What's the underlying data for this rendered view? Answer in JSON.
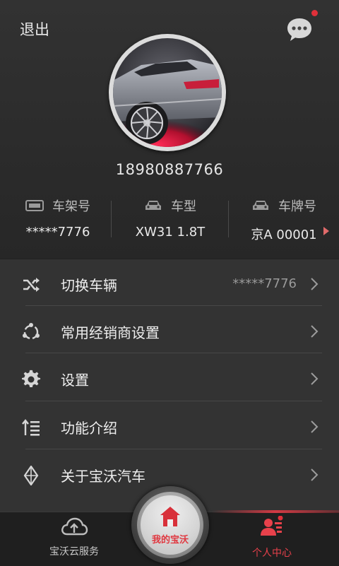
{
  "header": {
    "logout_label": "退出"
  },
  "profile": {
    "phone": "18980887766"
  },
  "vehicle_info": {
    "frame_label": "车架号",
    "frame_value": "*****7776",
    "model_label": "车型",
    "model_value": "XW31 1.8T",
    "plate_label": "车牌号",
    "plate_value": "京A 00001"
  },
  "menu": {
    "items": [
      {
        "label": "切换车辆",
        "value": "*****7776",
        "icon": "shuffle-icon"
      },
      {
        "label": "常用经销商设置",
        "value": "",
        "icon": "dealer-network-icon"
      },
      {
        "label": "设置",
        "value": "",
        "icon": "gear-icon"
      },
      {
        "label": "功能介绍",
        "value": "",
        "icon": "list-sort-icon"
      },
      {
        "label": "关于宝沃汽车",
        "value": "",
        "icon": "diamond-logo-icon"
      }
    ]
  },
  "tabbar": {
    "left_label": "宝沃云服务",
    "center_label": "我的宝沃",
    "right_label": "个人中心"
  },
  "colors": {
    "accent": "#e0303a",
    "background": "#2c2c2c"
  }
}
